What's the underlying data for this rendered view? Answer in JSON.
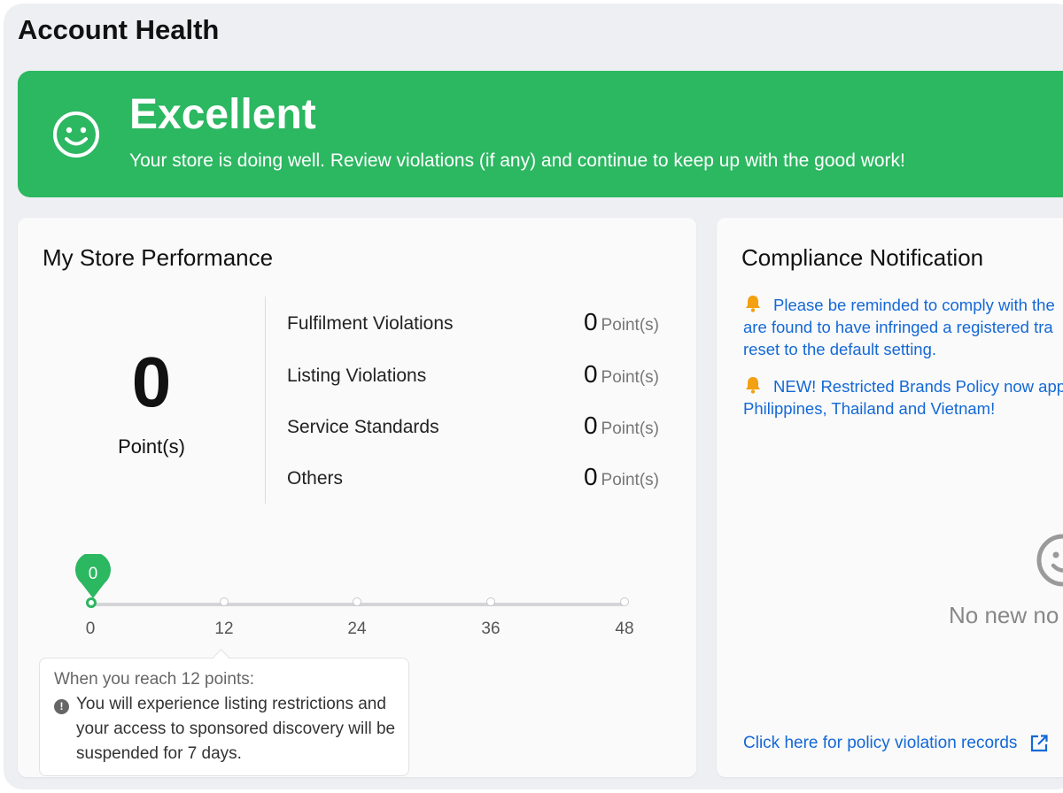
{
  "page": {
    "title": "Account Health"
  },
  "banner": {
    "status": "Excellent",
    "description": "Your store is doing well. Review violations (if any) and continue to keep up with the good work!",
    "color": "#2cb761",
    "icon": "smiley-icon"
  },
  "performance": {
    "title": "My Store Performance",
    "total_points": "0",
    "total_unit": "Point(s)",
    "violations": [
      {
        "label": "Fulfilment Violations",
        "points": "0",
        "unit": "Point(s)"
      },
      {
        "label": "Listing Violations",
        "points": "0",
        "unit": "Point(s)"
      },
      {
        "label": "Service Standards",
        "points": "0",
        "unit": "Point(s)"
      },
      {
        "label": "Others",
        "points": "0",
        "unit": "Point(s)"
      }
    ],
    "scale": {
      "ticks": [
        "0",
        "12",
        "24",
        "36",
        "48"
      ],
      "current_value": 0,
      "current_label": "0"
    },
    "tooltip": {
      "heading": "When you reach 12 points:",
      "body": "You will experience listing restrictions and your access to sponsored discovery will be suspended for 7 days.",
      "icon": "exclamation-icon"
    }
  },
  "compliance": {
    "title": "Compliance Notification",
    "notices": [
      {
        "icon": "bell-icon",
        "line1": "Please be reminded to comply with the",
        "line2": "are found to have infringed a registered tra",
        "line3": "reset to the default setting."
      },
      {
        "icon": "bell-icon",
        "line1": "NEW! Restricted Brands Policy now app",
        "line2": "Philippines, Thailand and Vietnam!"
      }
    ],
    "empty_text": "No new no",
    "empty_icon": "smiley-icon",
    "link_text": "Click here for policy violation records",
    "link_icon": "external-link-icon"
  },
  "colors": {
    "accent_green": "#2cb761",
    "link_blue": "#1468d6"
  }
}
